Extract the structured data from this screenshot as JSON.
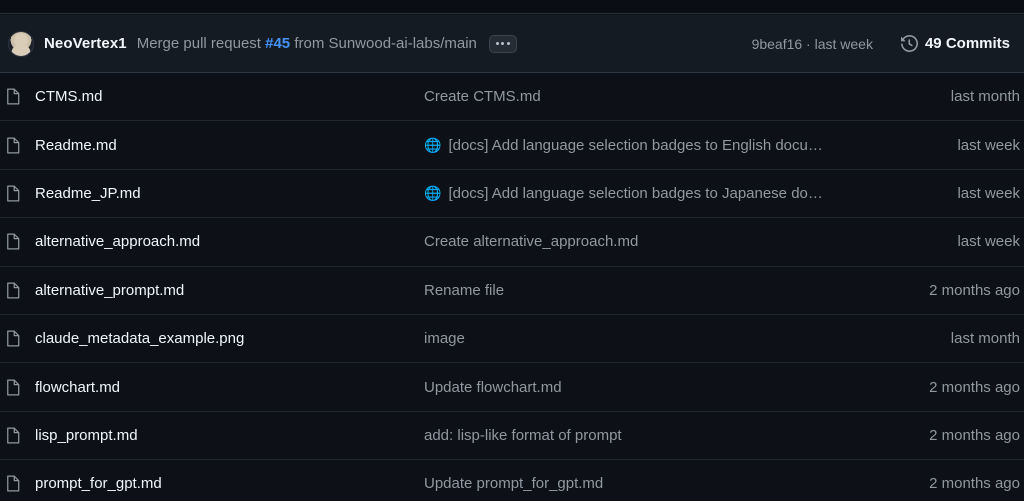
{
  "header": {
    "author": "NeoVertex1",
    "commit_message_prefix": "Merge pull request ",
    "pr_number": "#45",
    "commit_message_suffix": " from Sunwood-ai-labs/main",
    "expand_button_label": "...",
    "commit_ref": "9beaf16 · last week",
    "commits_count": "49 Commits",
    "link_color": "#4493f8"
  },
  "files": [
    {
      "name": "CTMS.md",
      "icon": "file-icon",
      "emoji": "",
      "message": "Create CTMS.md",
      "time": "last month"
    },
    {
      "name": "Readme.md",
      "icon": "file-icon",
      "emoji": "🌐",
      "message": "[docs] Add language selection badges to English docu…",
      "time": "last week"
    },
    {
      "name": "Readme_JP.md",
      "icon": "file-icon",
      "emoji": "🌐",
      "message": "[docs] Add language selection badges to Japanese do…",
      "time": "last week"
    },
    {
      "name": "alternative_approach.md",
      "icon": "file-icon",
      "emoji": "",
      "message": "Create alternative_approach.md",
      "time": "last week"
    },
    {
      "name": "alternative_prompt.md",
      "icon": "file-icon",
      "emoji": "",
      "message": "Rename file",
      "time": "2 months ago"
    },
    {
      "name": "claude_metadata_example.png",
      "icon": "file-icon",
      "emoji": "",
      "message": "image",
      "time": "last month"
    },
    {
      "name": "flowchart.md",
      "icon": "file-icon",
      "emoji": "",
      "message": "Update flowchart.md",
      "time": "2 months ago"
    },
    {
      "name": "lisp_prompt.md",
      "icon": "file-icon",
      "emoji": "",
      "message": "add: lisp-like format of prompt",
      "time": "2 months ago"
    },
    {
      "name": "prompt_for_gpt.md",
      "icon": "file-icon",
      "emoji": "",
      "message": "Update prompt_for_gpt.md",
      "time": "2 months ago"
    }
  ]
}
